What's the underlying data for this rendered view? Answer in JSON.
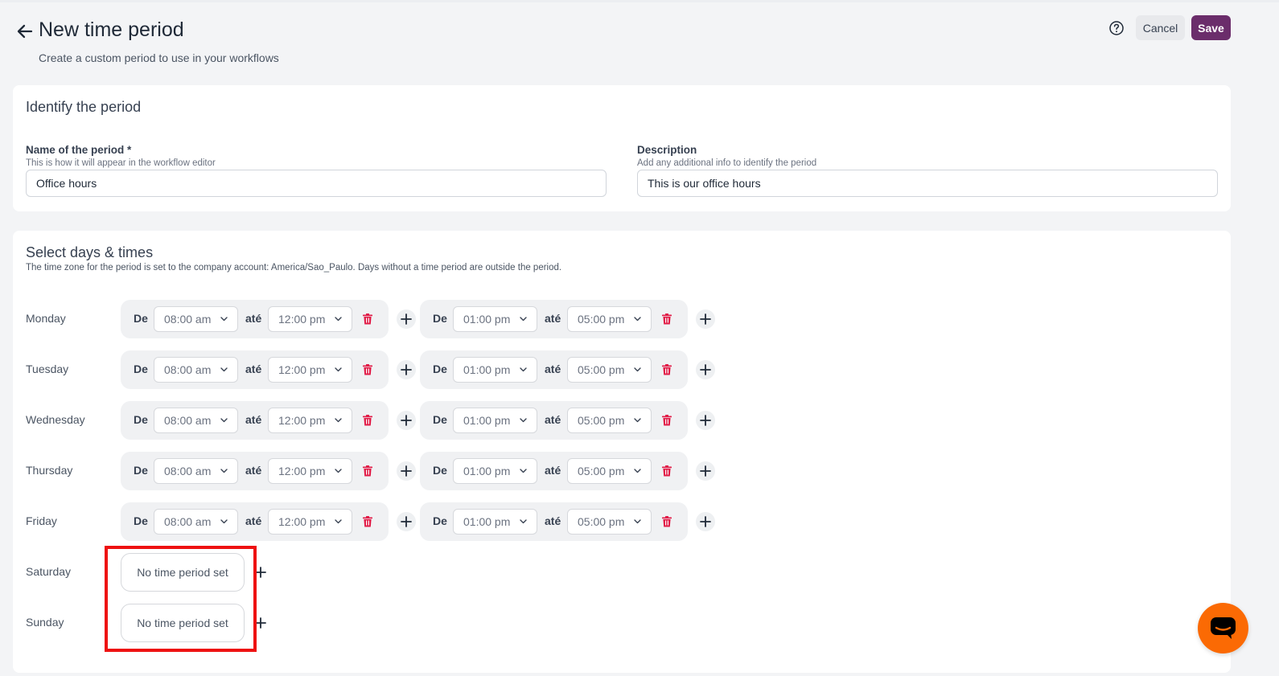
{
  "header": {
    "title": "New time period",
    "subtitle": "Create a custom period to use in your workflows",
    "cancel_label": "Cancel",
    "save_label": "Save",
    "save_color": "#6b2d6b"
  },
  "identify": {
    "title": "Identify the period",
    "name_label": "Name of the period *",
    "name_hint": "This is how it will appear in the workflow editor",
    "name_value": "Office hours",
    "description_label": "Description",
    "description_hint": "Add any additional info to identify the period",
    "description_value": "This is our office hours"
  },
  "schedule": {
    "title": "Select days & times",
    "help": "The time zone for the period is set to the company account: America/Sao_Paulo. Days without a time period are outside the period.",
    "from_label": "De",
    "to_label": "até",
    "empty_label": "No time period set",
    "days": [
      {
        "name": "Monday",
        "slots": [
          {
            "from": "08:00 am",
            "to": "12:00 pm"
          },
          {
            "from": "01:00 pm",
            "to": "05:00 pm"
          }
        ]
      },
      {
        "name": "Tuesday",
        "slots": [
          {
            "from": "08:00 am",
            "to": "12:00 pm"
          },
          {
            "from": "01:00 pm",
            "to": "05:00 pm"
          }
        ]
      },
      {
        "name": "Wednesday",
        "slots": [
          {
            "from": "08:00 am",
            "to": "12:00 pm"
          },
          {
            "from": "01:00 pm",
            "to": "05:00 pm"
          }
        ]
      },
      {
        "name": "Thursday",
        "slots": [
          {
            "from": "08:00 am",
            "to": "12:00 pm"
          },
          {
            "from": "01:00 pm",
            "to": "05:00 pm"
          }
        ]
      },
      {
        "name": "Friday",
        "slots": [
          {
            "from": "08:00 am",
            "to": "12:00 pm"
          },
          {
            "from": "01:00 pm",
            "to": "05:00 pm"
          }
        ]
      },
      {
        "name": "Saturday",
        "slots": []
      },
      {
        "name": "Sunday",
        "slots": []
      }
    ]
  },
  "icons": {
    "back": "arrow-left-icon",
    "help": "question-circle-icon",
    "delete": "trash-icon",
    "add": "plus-icon",
    "chevron": "chevron-down-icon",
    "chat": "chat-bubble-icon"
  },
  "colors": {
    "highlight": "#ee1111",
    "delete": "#e11d48",
    "chat": "#fb6a04"
  }
}
